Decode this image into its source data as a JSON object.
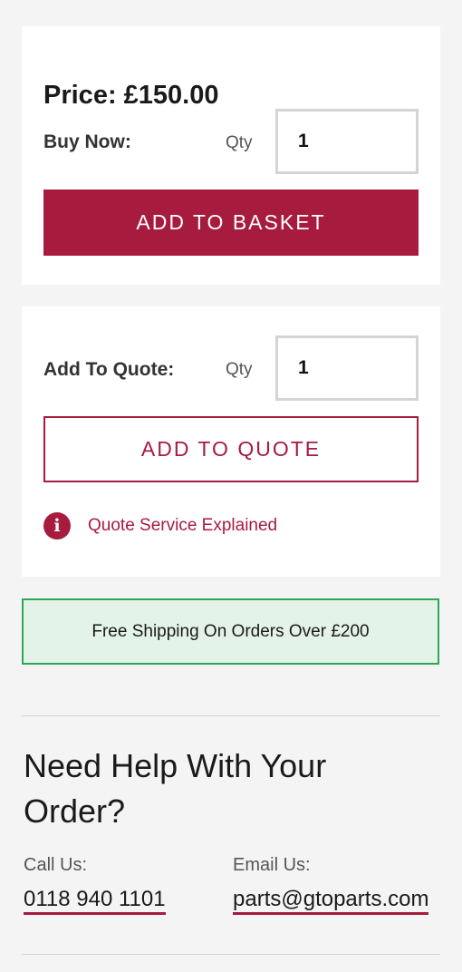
{
  "buy": {
    "price": "Price: £150.00",
    "buy_now_label": "Buy Now:",
    "qty_label": "Qty",
    "qty_value": "1",
    "add_to_basket_label": "ADD TO BASKET"
  },
  "quote": {
    "label": "Add To Quote:",
    "qty_label": "Qty",
    "qty_value": "1",
    "add_to_quote_label": "ADD TO QUOTE",
    "info_icon": "info-icon",
    "info_link_label": "Quote Service Explained"
  },
  "shipping": {
    "text": "Free Shipping On Orders Over £200"
  },
  "help": {
    "title": "Need Help With Your Order?",
    "call_label": "Call Us:",
    "phone": "0118 940 1101",
    "email_label": "Email Us:",
    "email": "parts@gtoparts.com"
  },
  "colors": {
    "accent": "#a71b3f",
    "shipping_border": "#2fa55b",
    "shipping_background": "#e4f3e8",
    "page_background": "#f4f4f4"
  }
}
